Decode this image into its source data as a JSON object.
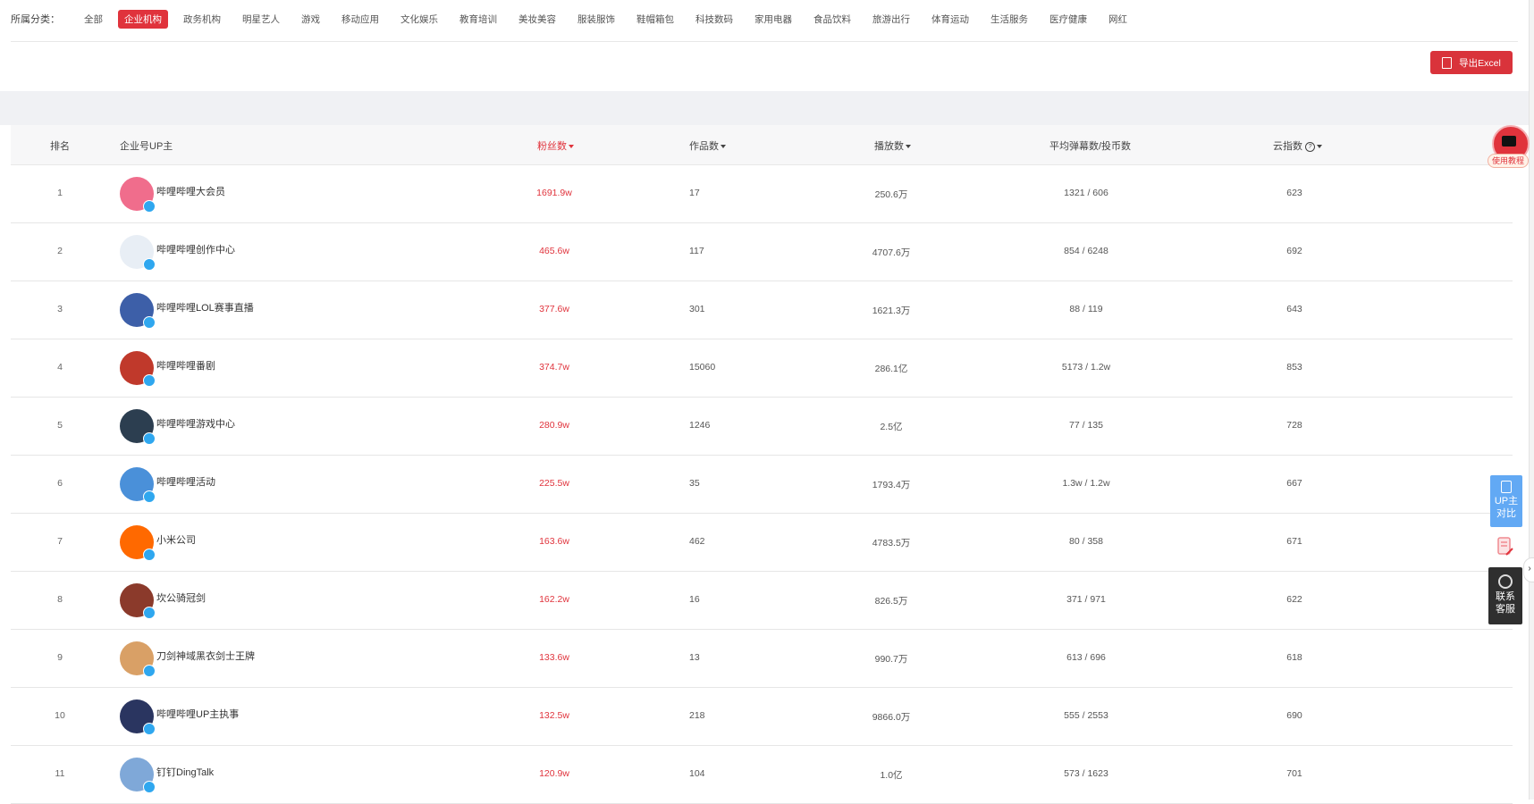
{
  "filter": {
    "label": "所属分类：",
    "items": [
      "全部",
      "企业机构",
      "政务机构",
      "明星艺人",
      "游戏",
      "移动应用",
      "文化娱乐",
      "教育培训",
      "美妆美容",
      "服装服饰",
      "鞋帽箱包",
      "科技数码",
      "家用电器",
      "食品饮料",
      "旅游出行",
      "体育运动",
      "生活服务",
      "医疗健康",
      "网红"
    ],
    "active_index": 1
  },
  "export_label": "导出Excel",
  "table": {
    "headers": {
      "rank": "排名",
      "owner": "企业号UP主",
      "fans": "粉丝数",
      "works": "作品数",
      "plays": "播放数",
      "avg": "平均弹幕数/投币数",
      "index": "云指数"
    },
    "rows": [
      {
        "rank": "1",
        "name": "哔哩哔哩大会员",
        "fans": "1691.9w",
        "works": "17",
        "plays": "250.6万",
        "avg": "1321 / 606",
        "index": "623"
      },
      {
        "rank": "2",
        "name": "哔哩哔哩创作中心",
        "fans": "465.6w",
        "works": "117",
        "plays": "4707.6万",
        "avg": "854 / 6248",
        "index": "692"
      },
      {
        "rank": "3",
        "name": "哔哩哔哩LOL赛事直播",
        "fans": "377.6w",
        "works": "301",
        "plays": "1621.3万",
        "avg": "88 / 119",
        "index": "643"
      },
      {
        "rank": "4",
        "name": "哔哩哔哩番剧",
        "fans": "374.7w",
        "works": "15060",
        "plays": "286.1亿",
        "avg": "5173 / 1.2w",
        "index": "853"
      },
      {
        "rank": "5",
        "name": "哔哩哔哩游戏中心",
        "fans": "280.9w",
        "works": "1246",
        "plays": "2.5亿",
        "avg": "77 / 135",
        "index": "728"
      },
      {
        "rank": "6",
        "name": "哔哩哔哩活动",
        "fans": "225.5w",
        "works": "35",
        "plays": "1793.4万",
        "avg": "1.3w / 1.2w",
        "index": "667"
      },
      {
        "rank": "7",
        "name": "小米公司",
        "fans": "163.6w",
        "works": "462",
        "plays": "4783.5万",
        "avg": "80 / 358",
        "index": "671"
      },
      {
        "rank": "8",
        "name": "坎公骑冠剑",
        "fans": "162.2w",
        "works": "16",
        "plays": "826.5万",
        "avg": "371 / 971",
        "index": "622"
      },
      {
        "rank": "9",
        "name": "刀剑神域黑衣剑士王牌",
        "fans": "133.6w",
        "works": "13",
        "plays": "990.7万",
        "avg": "613 / 696",
        "index": "618"
      },
      {
        "rank": "10",
        "name": "哔哩哔哩UP主执事",
        "fans": "132.5w",
        "works": "218",
        "plays": "9866.0万",
        "avg": "555 / 2553",
        "index": "690"
      },
      {
        "rank": "11",
        "name": "钉钉DingTalk",
        "fans": "120.9w",
        "works": "104",
        "plays": "1.0亿",
        "avg": "573 / 1623",
        "index": "701"
      }
    ]
  },
  "avatar_colors": [
    "#f06d8c",
    "#e8eef5",
    "#3d5fa8",
    "#c0392b",
    "#2c3e50",
    "#4a90d9",
    "#ff6900",
    "#8b3a2b",
    "#d9a066",
    "#2a3560",
    "#7fa8d8"
  ],
  "side": {
    "tutorial_label": "使用教程",
    "compare_label": "UP主对比",
    "service_label": "联系客服"
  }
}
